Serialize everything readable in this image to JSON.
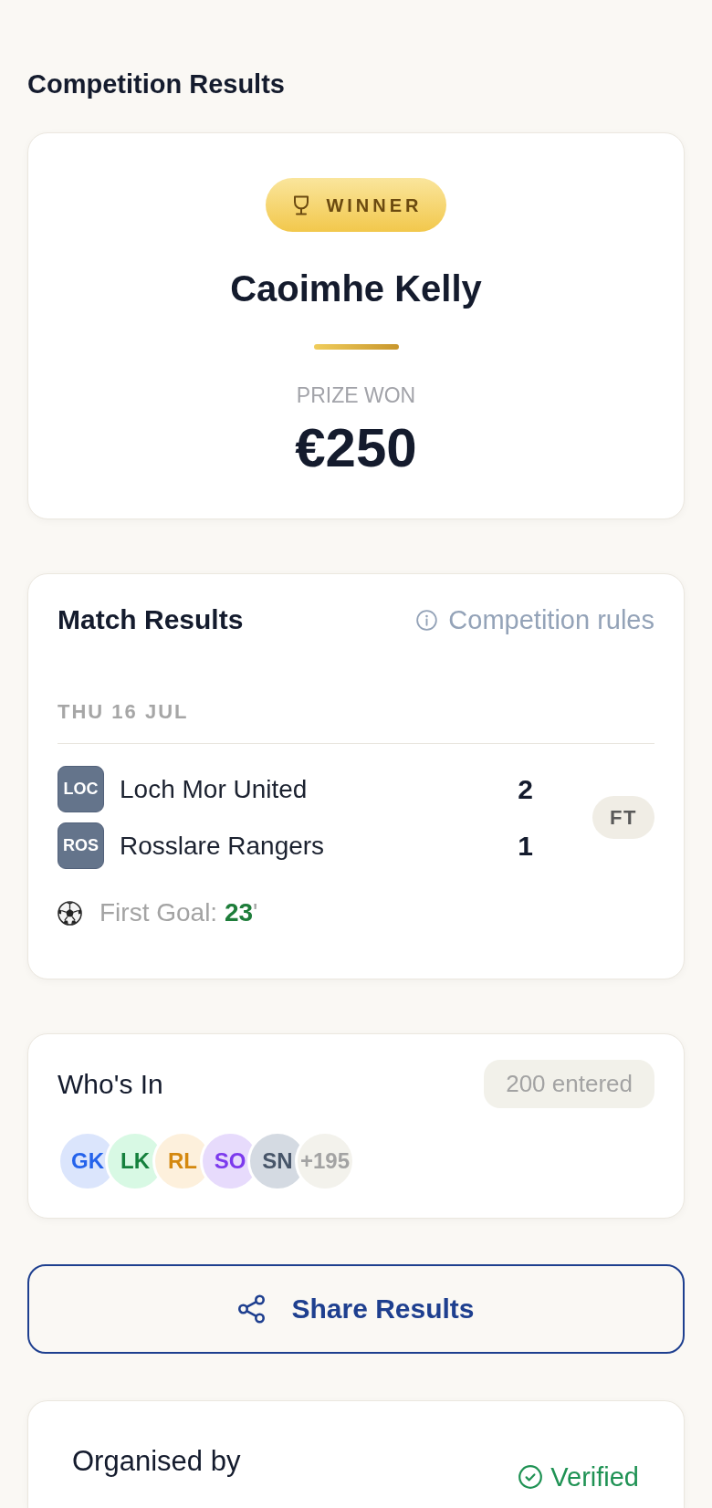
{
  "page_title": "Competition Results",
  "winner": {
    "badge": "WINNER",
    "name": "Caoimhe Kelly",
    "prize_label": "PRIZE WON",
    "prize": "€250"
  },
  "match_results": {
    "title": "Match Results",
    "rules_link": "Competition rules",
    "date": "THU 16 JUL",
    "teams": [
      {
        "abbr": "LOC",
        "name": "Loch Mor United",
        "score": "2"
      },
      {
        "abbr": "ROS",
        "name": "Rosslare Rangers",
        "score": "1"
      }
    ],
    "status": "FT",
    "first_goal": {
      "label": "First Goal:",
      "minute": "23",
      "unit": "'"
    }
  },
  "whos_in": {
    "title": "Who's In",
    "entered": "200 entered",
    "entrants": [
      {
        "initials": "GK",
        "color": "#2563eb"
      },
      {
        "initials": "LK",
        "color": "#15803d"
      },
      {
        "initials": "RL",
        "color": "#d4880f"
      },
      {
        "initials": "SO",
        "color": "#7c3aed"
      },
      {
        "initials": "SN",
        "color": "#475569"
      }
    ],
    "more": "+195"
  },
  "share_button": "Share Results",
  "organiser": {
    "title": "Organised by",
    "badge": "Verified"
  }
}
